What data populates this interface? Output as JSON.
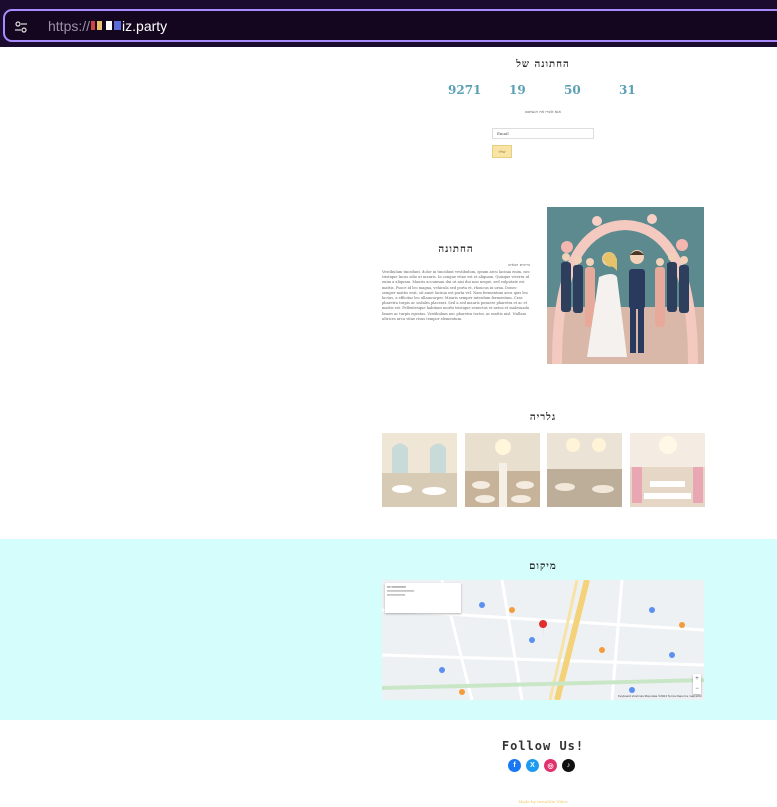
{
  "browser": {
    "url_prefix": "https://",
    "url_host": "iz.party"
  },
  "hero": {
    "title": "החתונה של",
    "countdown": [
      "9271",
      "19",
      "50",
      "31"
    ],
    "rsvp_note": "אנא אשרו את הגעתכם",
    "email_placeholder": "Email",
    "send_label": "שלח"
  },
  "about": {
    "title": "החתונה",
    "subtitle": "ברוכים הבאים",
    "text": "Vestibulum tincidunt, dolor in tincidunt vestibulum, ipsum arcu lacinia enim, nec tristique lacus odio ut mauris. In congue vitae est et aliquam. Quisque viverra id enim a aliquam. Mauris accumsan dui ut nisi dui non neque, sed vulputate est mattis. Fusce id leo magna, vehicula sed porta et, rhoncus in urna. Donec semper mattis erat, sit amet lacinia est porta vel. Nam fermentum arcu quis leo luctus, a efficitur leo ullamcorper. Mauris semper interdum fermentum. Cras pharetra turpis ac sodales placerat. Sed a sed mauris posuere pharetra et ac et mattis est. Pellentesque habitant morbi tristique senectus et netus et malesuada fames ac turpis egestas. Vestibulum nec pharetra tortor, ac mattis nisl. Nullam ultrices arcu vitae risus tempor elementum."
  },
  "gallery": {
    "title": "גלריה"
  },
  "location": {
    "title": "מיקום",
    "map_footer": "Keyboard shortcuts  Map data ©2024  Terms  Report a map error"
  },
  "footer": {
    "follow": "Follow Us!",
    "credit": "Made by InstaSite Vibes"
  },
  "colors": {
    "accent": "#5aa0b3",
    "location_bg": "#d4fdfb",
    "button": "#f8e4a4"
  }
}
